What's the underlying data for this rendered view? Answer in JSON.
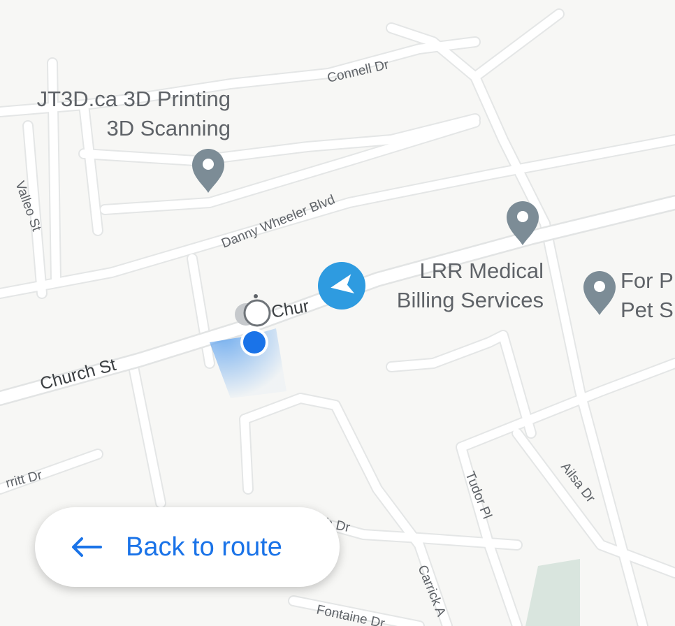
{
  "map": {
    "streets": [
      {
        "id": "connell",
        "label": "Connell Dr"
      },
      {
        "id": "danny",
        "label": "Danny Wheeler Blvd"
      },
      {
        "id": "valleo",
        "label": "Valleo St"
      },
      {
        "id": "church-main",
        "label": "Church St"
      },
      {
        "id": "church-partial",
        "label": "Chur"
      },
      {
        "id": "merritt",
        "label": "rritt Dr"
      },
      {
        "id": "tudor",
        "label": "Tudor Pl"
      },
      {
        "id": "ailsa",
        "label": "Ailsa Dr"
      },
      {
        "id": "beech",
        "label": "ch Dr"
      },
      {
        "id": "carrick",
        "label": "Carrick A"
      },
      {
        "id": "fontaine",
        "label": "Fontaine Dr"
      }
    ],
    "pois": [
      {
        "id": "jt3d",
        "lines": [
          "JT3D.ca 3D Printing",
          "3D Scanning"
        ]
      },
      {
        "id": "lrr",
        "lines": [
          "LRR Medical",
          "Billing Services"
        ]
      },
      {
        "id": "forpet",
        "lines": [
          "For P",
          "Pet S"
        ]
      }
    ],
    "colors": {
      "background": "#f7f7f5",
      "road": "#ffffff",
      "pin": "#7c8c96",
      "location": "#1a73e8",
      "navigation": "#2e9be0",
      "park": "#d9e5de"
    },
    "icons": [
      "map-pin-icon",
      "navigation-arrow-icon",
      "current-location-icon",
      "street-view-icon",
      "arrow-left-icon"
    ]
  },
  "back_button": {
    "label": "Back to route",
    "icon": "arrow-left-icon"
  }
}
